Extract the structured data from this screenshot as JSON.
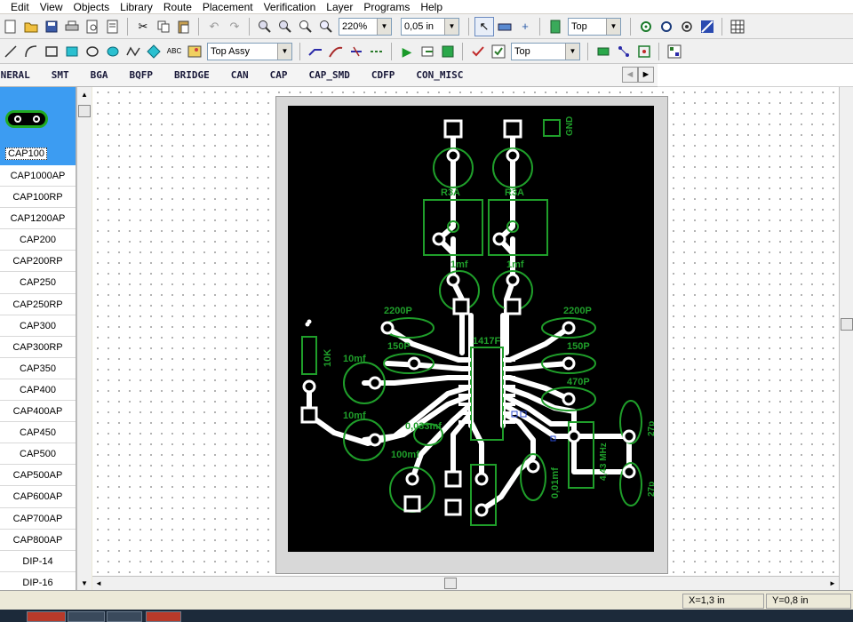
{
  "menu": [
    "Edit",
    "View",
    "Objects",
    "Library",
    "Route",
    "Placement",
    "Verification",
    "Layer",
    "Programs",
    "Help"
  ],
  "toolbar1": {
    "zoom": "220%",
    "grid": "0,05 in",
    "layer": "Top"
  },
  "toolbar2": {
    "view_layer": "Top Assy",
    "layer": "Top",
    "text_tool_label": "ABC"
  },
  "library_tabs": [
    "ENERAL",
    "SMT",
    "BGA",
    "BQFP",
    "BRIDGE",
    "CAN",
    "CAP",
    "CAP_SMD",
    "CDFP",
    "CON_MISC"
  ],
  "library_nav": {
    "prev": "◄",
    "next": "►"
  },
  "components": {
    "selected": "CAP100",
    "items": [
      "CAP1000AP",
      "CAP100RP",
      "CAP1200AP",
      "CAP200",
      "CAP200RP",
      "CAP250",
      "CAP250RP",
      "CAP300",
      "CAP300RP",
      "CAP350",
      "CAP400",
      "CAP400AP",
      "CAP450",
      "CAP500",
      "CAP500AP",
      "CAP600AP",
      "CAP700AP",
      "CAP800AP",
      "DIP-14",
      "DIP-16"
    ]
  },
  "board": {
    "labels": {
      "gnd": "GND",
      "fuse_left": "R3A",
      "fuse_right": "R3A",
      "cap_1mf_left": "1mf",
      "cap_1mf_right": "1mf",
      "c_2200p_left": "2200P",
      "c_2200p_right": "2200P",
      "c_150p_left": "150P",
      "c_150p_right": "150P",
      "c_470p": "470P",
      "ic": "1417F",
      "r_10k": "10K",
      "c_10mf_top": "10mf",
      "c_10mf_bottom": "10mf",
      "c_0033": "0,033mf",
      "c_100mf": "100mf",
      "c_001": "0,01mf",
      "crystal": "4,43 MHz",
      "c_27p_top": "27p",
      "c_27p_bottom": "27p"
    }
  },
  "status": {
    "x": "X=1,3 in",
    "y": "Y=0,8 in"
  },
  "colors": {
    "board": "#000000",
    "silk": "#1f9e2a",
    "copper": "#ffffff",
    "selected": "#3c9cf2"
  }
}
